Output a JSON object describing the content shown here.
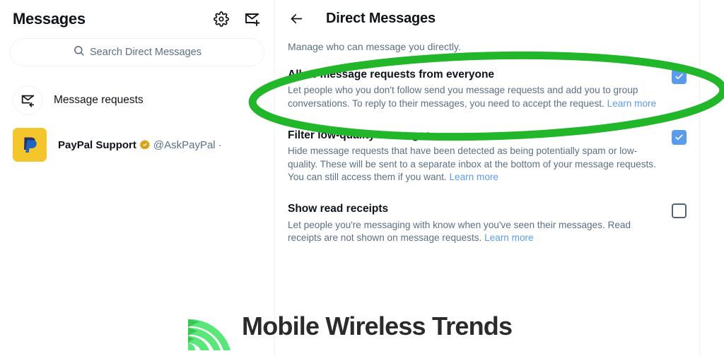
{
  "left_panel": {
    "title": "Messages",
    "icons": {
      "settings": "gear-icon",
      "new_message": "new-message-icon"
    },
    "search": {
      "placeholder": "Search Direct Messages",
      "icon": "search-icon",
      "value": ""
    },
    "items": [
      {
        "type": "message-requests",
        "label": "Message requests",
        "icon": "envelope-reply-icon"
      },
      {
        "type": "conversation",
        "name": "PayPal Support",
        "handle": "@AskPayPal",
        "separator": "·",
        "verified": true,
        "verified_badge_color": "#d6a419",
        "avatar": "paypal-logo-icon",
        "avatar_bg": "#f5c52c"
      }
    ]
  },
  "right_panel": {
    "back_icon": "arrow-left-icon",
    "title": "Direct Messages",
    "subtitle": "Manage who can message you directly.",
    "settings": [
      {
        "title": "Allow message requests from everyone",
        "description": "Let people who you don't follow send you message requests and add you to group conversations. To reply to their messages, you need to accept the request.",
        "link_label": "Learn more",
        "checked": true
      },
      {
        "title": "Filter low-quality messages",
        "description": "Hide message requests that have been detected as being potentially spam or low-quality. These will be sent to a separate inbox at the bottom of your message requests. You can still access them if you want.",
        "link_label": "Learn more",
        "checked": true
      },
      {
        "title": "Show read receipts",
        "description": "Let people you're messaging with know when you've seen their messages. Read receipts are not shown on message requests.",
        "link_label": "Learn more",
        "checked": false
      }
    ]
  },
  "annotation": {
    "shape": "ellipse",
    "color": "#22b62a",
    "target": "Allow message requests from everyone"
  },
  "watermark": {
    "text": "Mobile Wireless Trends",
    "icon": "signal-waves-icon",
    "icon_color": "#5ae77a",
    "text_color": "#2b2b2b"
  },
  "colors": {
    "accent_blue": "#5b9bec",
    "link_blue": "#5b9bec",
    "text_primary": "#0f1419",
    "text_secondary": "#5b7083",
    "border": "#eff3f4",
    "annotation_green": "#22b62a"
  }
}
